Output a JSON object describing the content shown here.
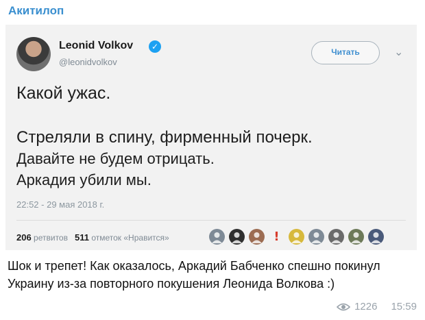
{
  "channel": {
    "name": "Акитилоп"
  },
  "tweet": {
    "author_name": "Leonid Volkov",
    "author_handle": "@leonidvolkov",
    "follow_label": "Читать",
    "lines": [
      "Какой ужас.",
      "Стреляли в спину, фирменный почерк.",
      "Давайте не будем отрицать.",
      "Аркадия убили мы."
    ],
    "timestamp": "22:52 - 29 мая 2018 г.",
    "retweets_count": "206",
    "retweets_label": "ретвитов",
    "likes_count": "511",
    "likes_label": "отметок «Нравится»",
    "likers": [
      {
        "icon": "person-avatar-icon",
        "color": "#7e8a96"
      },
      {
        "icon": "person-avatar-icon",
        "color": "#2f2f2f"
      },
      {
        "icon": "person-avatar-icon",
        "color": "#9c6c52"
      },
      {
        "icon": "exclamation-avatar-icon",
        "color": "#d73c2c"
      },
      {
        "icon": "person-avatar-icon",
        "color": "#d7b93c"
      },
      {
        "icon": "person-avatar-icon",
        "color": "#7e8a96"
      },
      {
        "icon": "person-avatar-icon",
        "color": "#6b6b6b"
      },
      {
        "icon": "person-avatar-icon",
        "color": "#6d7a59"
      },
      {
        "icon": "person-avatar-icon",
        "color": "#4a5a7a"
      }
    ]
  },
  "post": {
    "caption": "Шок и трепет! Как оказалось, Аркадий Бабченко спешно покинул Украину из-за повторного покушения Леонида Волкова :)",
    "views": "1226",
    "time": "15:59"
  },
  "colors": {
    "accent": "#3a8fcf",
    "verified": "#1da1f2"
  }
}
